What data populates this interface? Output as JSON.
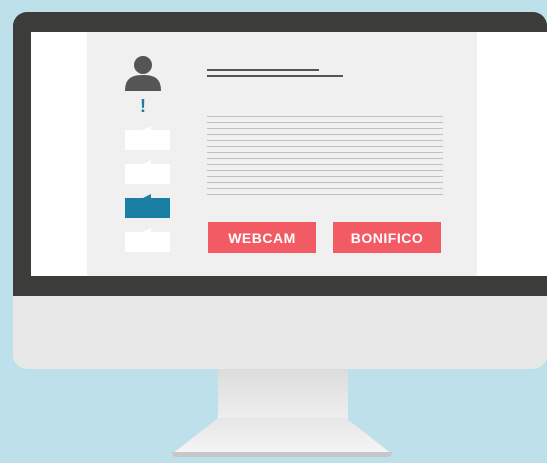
{
  "colors": {
    "accent": "#f25b63",
    "step_active": "#1b7fa3",
    "bezel": "#3c3c3b",
    "background": "#bde0ea"
  },
  "icons": {
    "profile": "user-avatar-icon",
    "alert": "exclamation-icon"
  },
  "alert": {
    "glyph": "!"
  },
  "steps": [
    {
      "state": "inactive"
    },
    {
      "state": "inactive"
    },
    {
      "state": "active"
    },
    {
      "state": "inactive"
    }
  ],
  "buttons": {
    "webcam_label": "WEBCAM",
    "bonifico_label": "BONIFICO"
  }
}
